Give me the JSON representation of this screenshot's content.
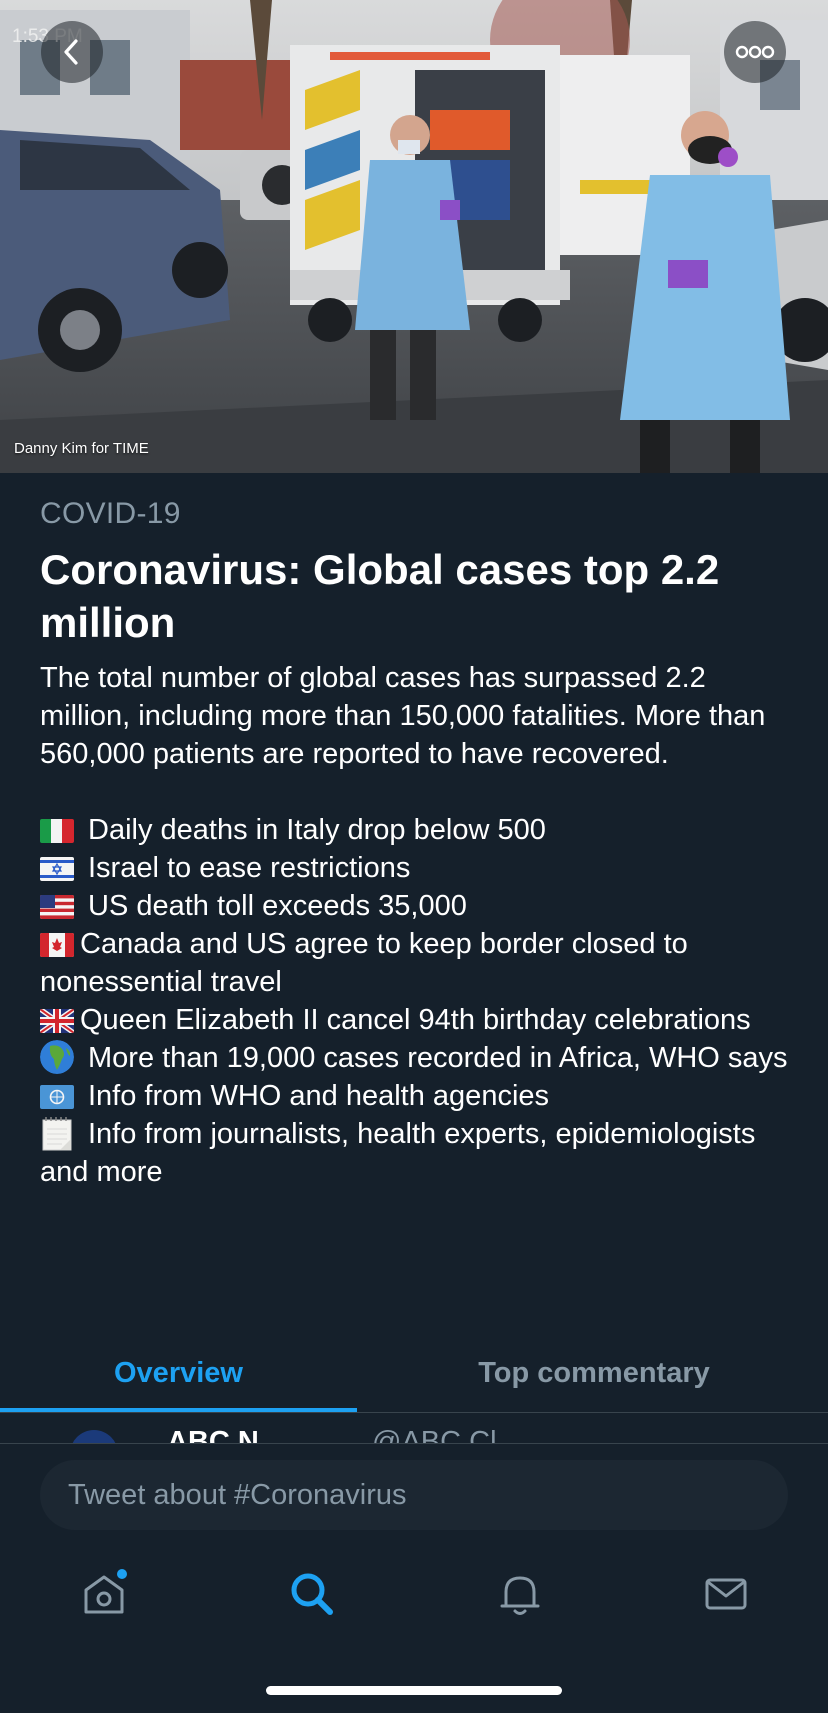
{
  "status_bar": {
    "time": "1:53 PM"
  },
  "hero": {
    "photo_credit": "Danny Kim for TIME"
  },
  "article": {
    "category": "COVID-19",
    "title": "Coronavirus: Global cases top 2.2 million",
    "description": "The total number of global cases has surpassed 2.2 million, including more than 150,000 fatalities. More than 560,000 patients are reported to have recovered.",
    "bullets": [
      {
        "icon": "italy-flag-icon",
        "text": "Daily deaths in Italy drop below 500"
      },
      {
        "icon": "israel-flag-icon",
        "text": "Israel to ease restrictions"
      },
      {
        "icon": "us-flag-icon",
        "text": "US death toll exceeds 35,000"
      },
      {
        "icon": "canada-flag-icon",
        "text": "Canada and US agree to keep  border closed to nonessential travel"
      },
      {
        "icon": "uk-flag-icon",
        "text": "Queen Elizabeth II cancel 94th birthday celebrations"
      },
      {
        "icon": "globe-africa-icon",
        "text": "More than 19,000 cases recorded in Africa, WHO says"
      },
      {
        "icon": "un-flag-icon",
        "text": "Info from WHO and health agencies"
      },
      {
        "icon": "notepad-icon",
        "text": "Info from journalists, health experts, epidemiologists and more"
      }
    ]
  },
  "tabs": [
    {
      "label": "Overview",
      "selected": true
    },
    {
      "label": "Top commentary",
      "selected": false
    }
  ],
  "peek_tweet": {
    "name": "ABC N",
    "handle": "@ABC  Cl"
  },
  "compose": {
    "placeholder": "Tweet about #Coronavirus"
  },
  "nav": {
    "items": [
      "home-icon",
      "search-icon",
      "notifications-icon",
      "messages-icon"
    ],
    "active": "search-icon"
  },
  "colors": {
    "background": "#15202b",
    "accent": "#1da1f2",
    "secondary_text": "#8899a6",
    "divider": "#38444d"
  }
}
